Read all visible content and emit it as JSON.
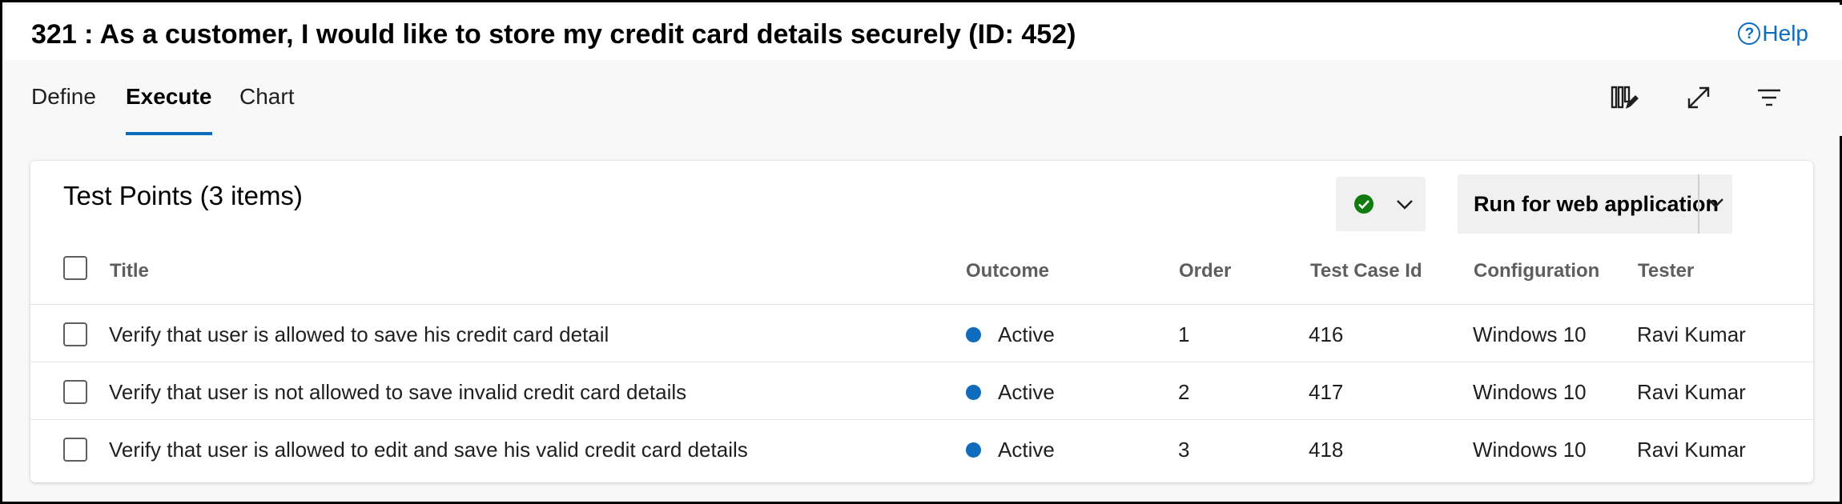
{
  "header": {
    "title": "321 : As a customer, I would like to store my credit card details securely (ID: 452)",
    "help_label": "Help",
    "help_icon": "question-circle-icon"
  },
  "tabs": [
    {
      "label": "Define",
      "active": false
    },
    {
      "label": "Execute",
      "active": true
    },
    {
      "label": "Chart",
      "active": false
    }
  ],
  "toolbar": {
    "icons": [
      "column-options-icon",
      "expand-icon",
      "filter-icon"
    ]
  },
  "panel": {
    "title": "Test Points (3 items)",
    "outcome_icon": "green-check-icon",
    "run_label": "Run for web application",
    "accent_color": "#0f6cbd",
    "pass_color": "#107c10"
  },
  "table": {
    "columns": [
      "Title",
      "Outcome",
      "Order",
      "Test Case Id",
      "Configuration",
      "Tester"
    ],
    "rows": [
      {
        "title": "Verify that user is allowed to save his credit card detail",
        "outcome": "Active",
        "order": "1",
        "test_case_id": "416",
        "configuration": "Windows 10",
        "tester": "Ravi Kumar"
      },
      {
        "title": "Verify that user is not allowed to save invalid credit card details",
        "outcome": "Active",
        "order": "2",
        "test_case_id": "417",
        "configuration": "Windows 10",
        "tester": "Ravi Kumar"
      },
      {
        "title": "Verify that user is allowed to edit and save his valid credit card details",
        "outcome": "Active",
        "order": "3",
        "test_case_id": "418",
        "configuration": "Windows 10",
        "tester": "Ravi Kumar"
      }
    ]
  }
}
